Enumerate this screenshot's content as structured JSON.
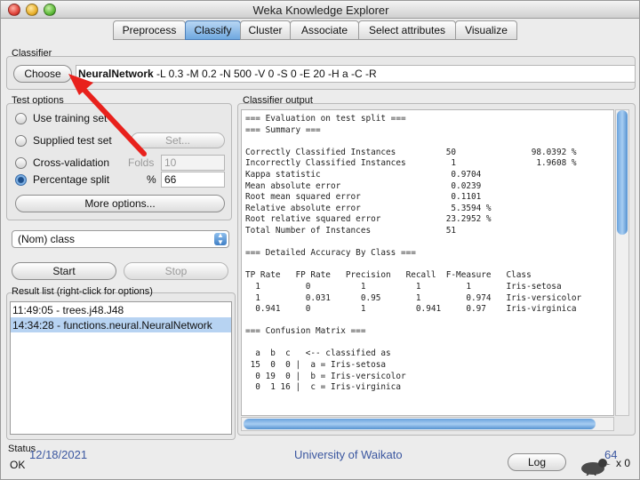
{
  "window": {
    "title": "Weka Knowledge Explorer"
  },
  "tabs": [
    {
      "label": "Preprocess"
    },
    {
      "label": "Classify",
      "active": true
    },
    {
      "label": "Cluster"
    },
    {
      "label": "Associate"
    },
    {
      "label": "Select attributes"
    },
    {
      "label": "Visualize"
    }
  ],
  "classifier": {
    "group_label": "Classifier",
    "choose_label": "Choose",
    "name": "NeuralNetwork",
    "options": " -L 0.3 -M 0.2 -N 500 -V 0 -S 0 -E 20 -H a -C -R"
  },
  "test_options": {
    "group_label": "Test options",
    "use_training_set": "Use training set",
    "supplied_test_set": "Supplied test set",
    "set_button": "Set...",
    "cross_validation": "Cross-validation",
    "folds_label": "Folds",
    "folds_value": "10",
    "percentage_split": "Percentage split",
    "percent_symbol": "%",
    "percent_value": "66",
    "more_options": "More options...",
    "selected": "percentage_split"
  },
  "class_select": {
    "value": "(Nom) class"
  },
  "actions": {
    "start": "Start",
    "stop": "Stop"
  },
  "result_list": {
    "label": "Result list (right-click for options)",
    "items": [
      {
        "text": "11:49:05 - trees.j48.J48"
      },
      {
        "text": "14:34:28 - functions.neural.NeuralNetwork",
        "selected": true
      }
    ]
  },
  "output": {
    "label": "Classifier output",
    "text": "=== Evaluation on test split ===\n=== Summary ===\n\nCorrectly Classified Instances          50               98.0392 %\nIncorrectly Classified Instances         1                1.9608 %\nKappa statistic                          0.9704\nMean absolute error                      0.0239\nRoot mean squared error                  0.1101\nRelative absolute error                  5.3594 %\nRoot relative squared error             23.2952 %\nTotal Number of Instances               51\n\n=== Detailed Accuracy By Class ===\n\nTP Rate   FP Rate   Precision   Recall  F-Measure   Class\n  1         0          1          1         1       Iris-setosa\n  1         0.031      0.95       1         0.974   Iris-versicolor\n  0.941     0          1          0.941     0.97    Iris-virginica\n\n=== Confusion Matrix ===\n\n  a  b  c   <-- classified as\n 15  0  0 |  a = Iris-setosa\n  0 19  0 |  b = Iris-versicolor\n  0  1 16 |  c = Iris-virginica"
  },
  "status": {
    "label": "Status",
    "value": "OK",
    "log_button": "Log",
    "count": "x 0"
  },
  "footer": {
    "date": "12/18/2021",
    "institution": "University of Waikato",
    "page": "64"
  },
  "colors": {
    "active_tab": "#6fa8e0",
    "annotation_arrow": "#e8211c",
    "footer_text": "#3b57a0"
  }
}
